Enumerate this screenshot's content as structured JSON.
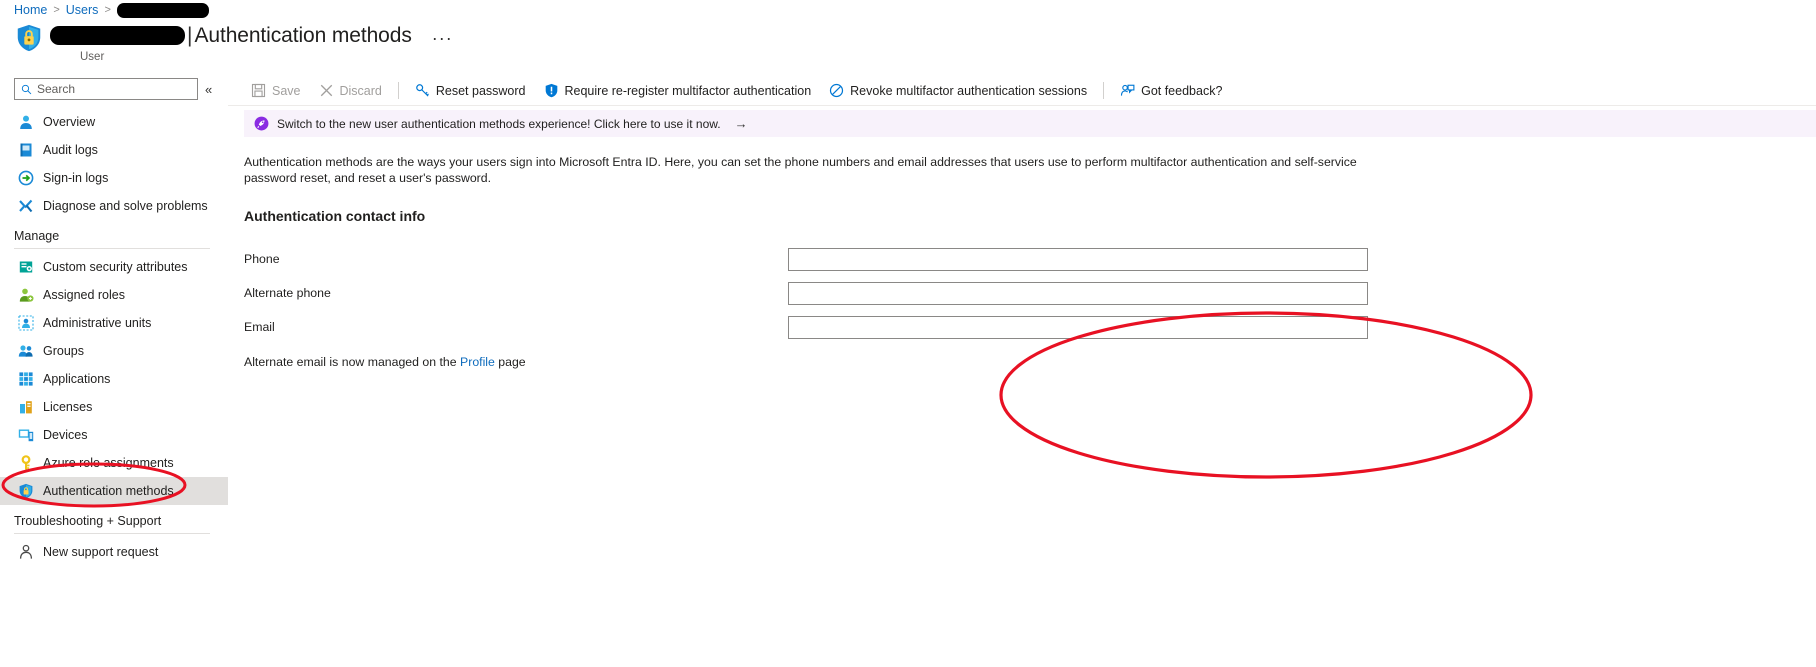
{
  "breadcrumb": {
    "home": "Home",
    "users": "Users",
    "redacted": "",
    "separator": ">"
  },
  "header": {
    "title": "Authentication methods",
    "pipe": "|",
    "subtitle": "User",
    "more_label": "···",
    "icon": "shield-lock-icon"
  },
  "sidebar": {
    "search_placeholder": "Search",
    "collapse_label": "«",
    "items": [
      {
        "label": "Overview",
        "icon": "user-icon",
        "selected": false
      },
      {
        "label": "Audit logs",
        "icon": "audit-log-icon",
        "selected": false
      },
      {
        "label": "Sign-in logs",
        "icon": "sign-in-icon",
        "selected": false
      },
      {
        "label": "Diagnose and solve problems",
        "icon": "diagnose-icon",
        "selected": false
      }
    ],
    "manage_section": "Manage",
    "manage_items": [
      {
        "label": "Custom security attributes",
        "icon": "custom-attributes-icon",
        "selected": false
      },
      {
        "label": "Assigned roles",
        "icon": "assigned-roles-icon",
        "selected": false
      },
      {
        "label": "Administrative units",
        "icon": "administrative-units-icon",
        "selected": false
      },
      {
        "label": "Groups",
        "icon": "groups-icon",
        "selected": false
      },
      {
        "label": "Applications",
        "icon": "applications-icon",
        "selected": false
      },
      {
        "label": "Licenses",
        "icon": "licenses-icon",
        "selected": false
      },
      {
        "label": "Devices",
        "icon": "devices-icon",
        "selected": false
      },
      {
        "label": "Azure role assignments",
        "icon": "key-icon",
        "selected": false
      },
      {
        "label": "Authentication methods",
        "icon": "shield-lock-icon",
        "selected": true
      }
    ],
    "support_section": "Troubleshooting + Support",
    "support_items": [
      {
        "label": "New support request",
        "icon": "support-request-icon",
        "selected": false
      }
    ]
  },
  "toolbar": {
    "save_label": "Save",
    "discard_label": "Discard",
    "reset_password_label": "Reset password",
    "require_reregister_label": "Require re-register multifactor authentication",
    "revoke_sessions_label": "Revoke multifactor authentication sessions",
    "feedback_label": "Got feedback?"
  },
  "banner": {
    "text": "Switch to the new user authentication methods experience! Click here to use it now.",
    "arrow": "→",
    "icon": "rocket-icon",
    "background": "#f8f2fb",
    "icon_color": "#8a2be2"
  },
  "main": {
    "description": "Authentication methods are the ways your users sign into Microsoft Entra ID. Here, you can set the phone numbers and email addresses that users use to perform multifactor authentication and self-service password reset, and reset a user's password.",
    "section_heading": "Authentication contact info",
    "fields": [
      {
        "label": "Phone",
        "value": "",
        "placeholder": ""
      },
      {
        "label": "Alternate phone",
        "value": "",
        "placeholder": ""
      },
      {
        "label": "Email",
        "value": "",
        "placeholder": ""
      }
    ],
    "alt_email_prefix": "Alternate email is now managed on the ",
    "alt_email_link": "Profile",
    "alt_email_suffix": " page"
  },
  "annotations": {
    "color": "#e81123",
    "sidebar_ellipse": "highlights Authentication methods nav item",
    "fields_ellipse": "highlights Phone, Alternate phone and Email inputs"
  },
  "colors": {
    "link": "#0f6cbd",
    "accent": "#0078d4",
    "annotation_red": "#e81123",
    "selected_bg": "#e1dfdd"
  }
}
